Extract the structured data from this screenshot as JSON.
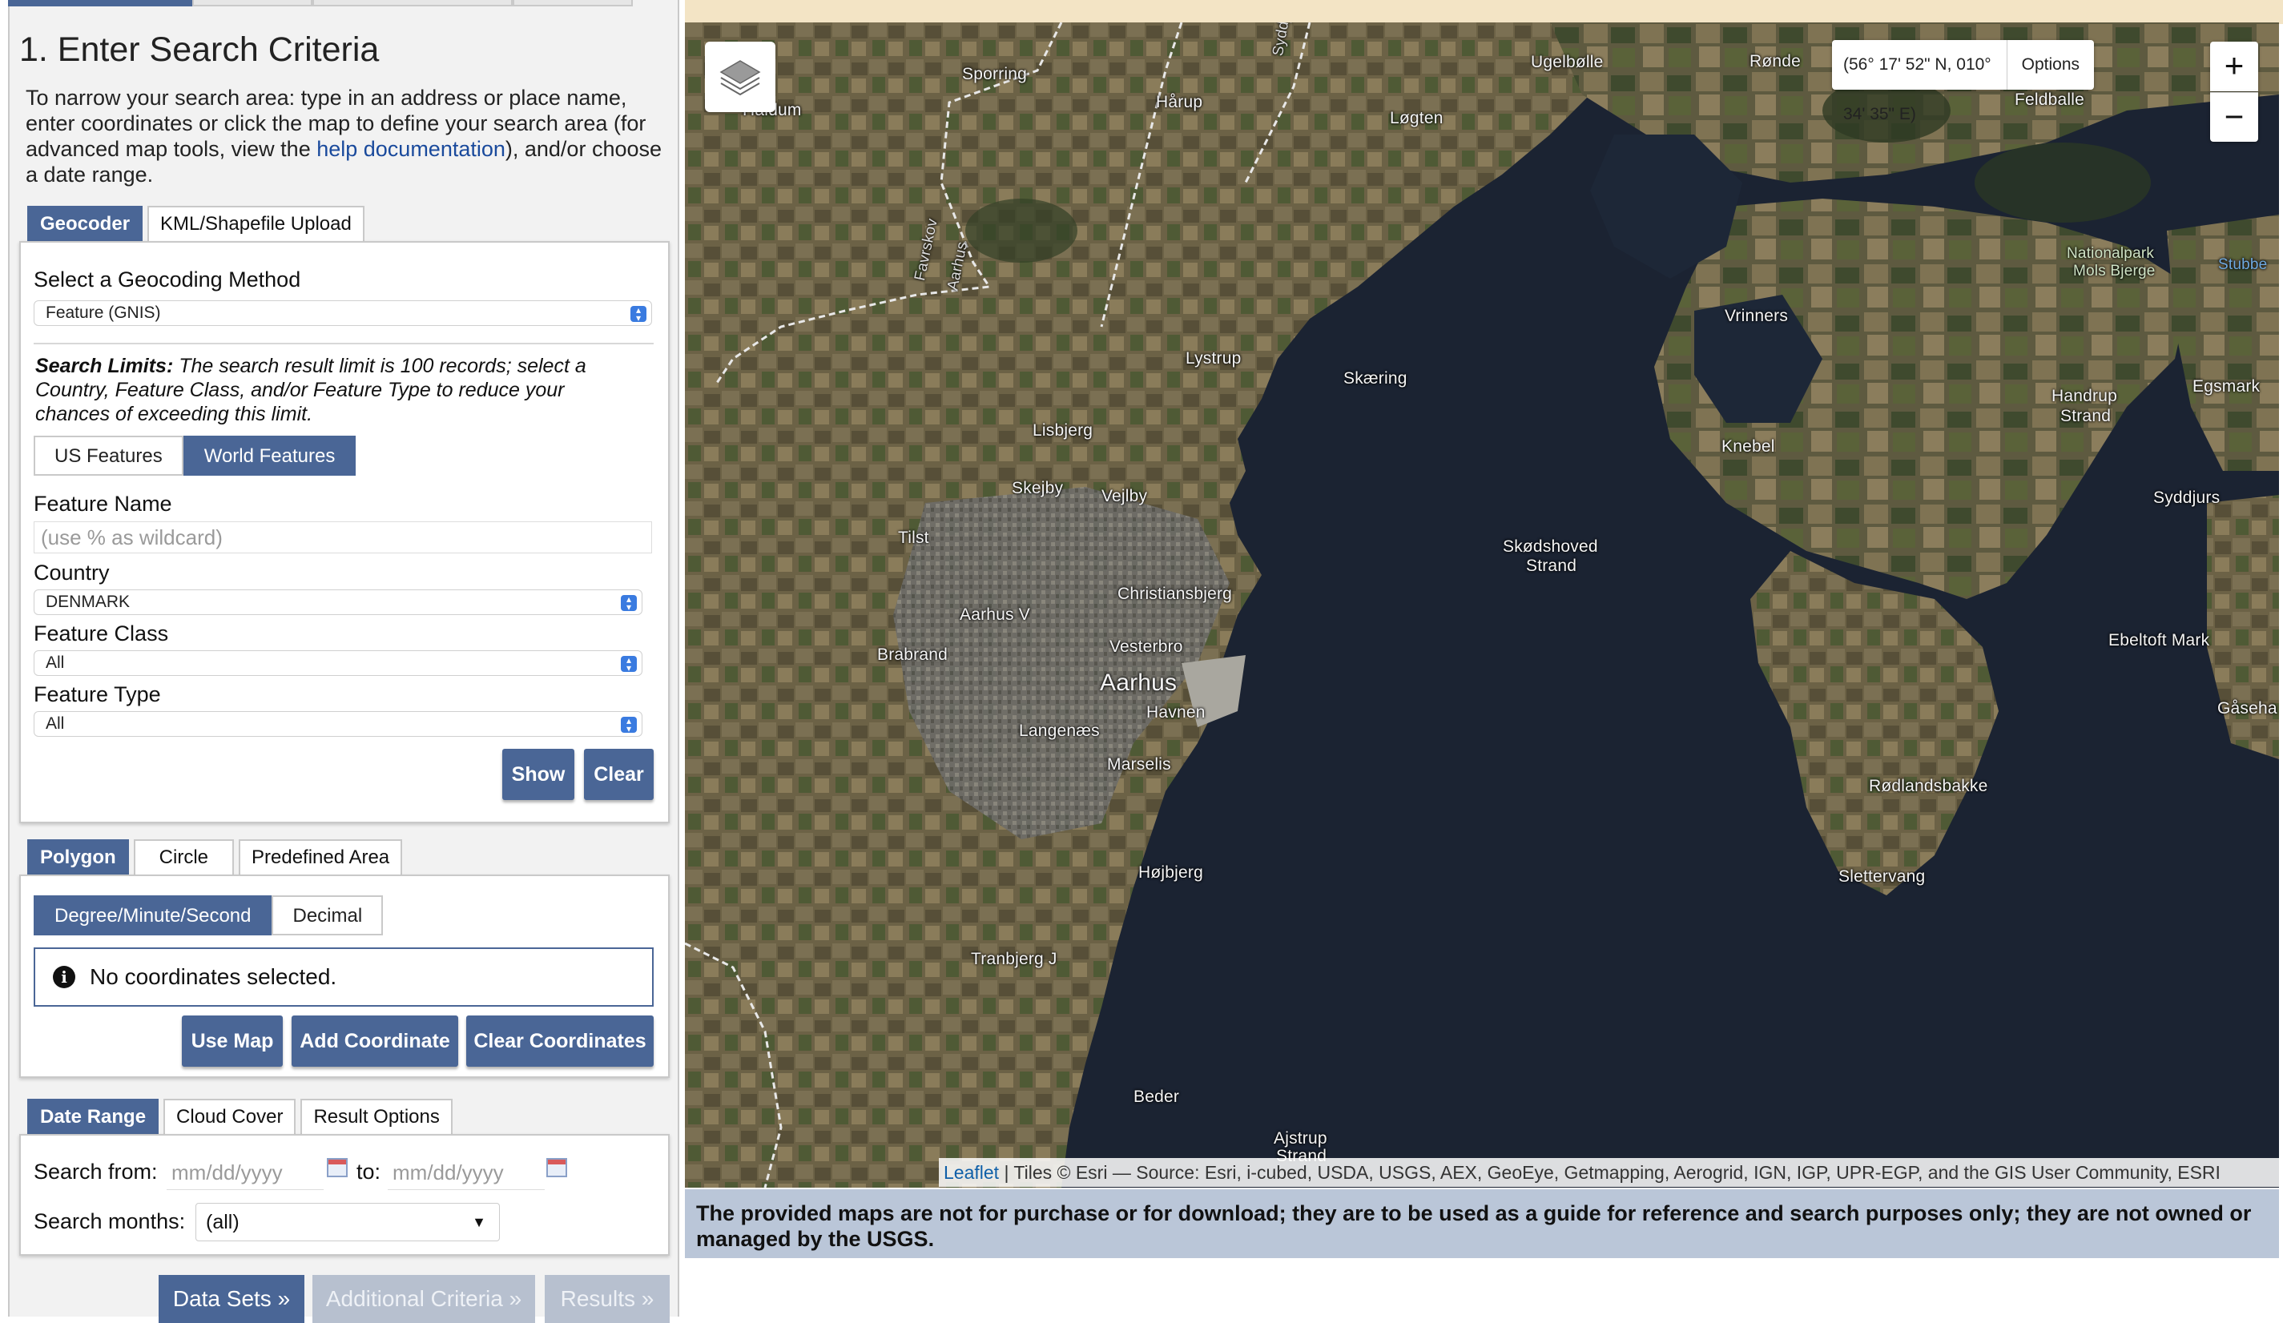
{
  "left_panel": {
    "heading": "1. Enter Search Criteria",
    "intro_part1": "To narrow your search area: type in an address or place name, enter coordinates or click the map to define your search area (for advanced map tools, view the ",
    "intro_link": "help documentation",
    "intro_part2": "), and/or choose a date range.",
    "top_tabs": [
      "Geocoder",
      "KML/Shapefile Upload"
    ],
    "geocoding_method_label": "Select a Geocoding Method",
    "geocoding_method_value": "Feature (GNIS)",
    "search_limits_bold": "Search Limits:",
    "search_limits_text": " The search result limit is 100 records; select a Country, Feature Class, and/or Feature Type to reduce your chances of exceeding this limit.",
    "feature_toggle": [
      "US Features",
      "World Features"
    ],
    "feature_name_label": "Feature Name",
    "feature_name_placeholder": "(use % as wildcard)",
    "country_label": "Country",
    "country_value": "DENMARK",
    "feature_class_label": "Feature Class",
    "feature_class_value": "All",
    "feature_type_label": "Feature Type",
    "feature_type_value": "All",
    "show_button": "Show",
    "clear_button": "Clear",
    "area_tabs": [
      "Polygon",
      "Circle",
      "Predefined Area"
    ],
    "coord_format": [
      "Degree/Minute/Second",
      "Decimal"
    ],
    "no_coords": "No coordinates selected.",
    "use_map_button": "Use Map",
    "add_coord_button": "Add Coordinate",
    "clear_coords_button": "Clear Coordinates",
    "date_tabs": [
      "Date Range",
      "Cloud Cover",
      "Result Options"
    ],
    "search_from_label": "Search from:",
    "to_label": "to:",
    "date_placeholder": "mm/dd/yyyy",
    "search_months_label": "Search months:",
    "search_months_value": "(all)",
    "nav_buttons": [
      "Data Sets »",
      "Additional Criteria »",
      "Results »"
    ]
  },
  "map": {
    "coord_readout": "(56° 17' 52\" N, 010° 34' 35\" E)",
    "options_label": "Options",
    "zoom_in": "+",
    "zoom_out": "−",
    "attribution_link": "Leaflet",
    "attribution_text": " | Tiles © Esri — Source: Esri, i-cubed, USDA, USGS, AEX, GeoEye, Getmapping, Aerogrid, IGN, IGP, UPR-EGP, and the GIS User Community, ESRI",
    "disclaimer": "The provided maps are not for purchase or for download; they are to be used as a guide for reference and search purposes only; they are not owned or managed by the USGS.",
    "labels": {
      "sporring": "Sporring",
      "syddjurs_road": "Syddjurs",
      "ugelbolle": "Ugelbølle",
      "ronde": "Rønde",
      "haldum": "Haldum",
      "harup": "Hårup",
      "logten": "Løgten",
      "feldballe": "Feldballe",
      "favrskov": "Favrskov",
      "aarhus_road": "Aarhus",
      "nationalpark": "Nationalpark",
      "mols_bjerge": "Mols Bjerge",
      "stubbe": "Stubbe",
      "vrinners": "Vrinners",
      "lystrup": "Lystrup",
      "skaering": "Skæring",
      "egsmark": "Egsmark",
      "handrup": "Handrup",
      "strand1": "Strand",
      "lisbjerg": "Lisbjerg",
      "knebel": "Knebel",
      "skejby": "Skejby",
      "vejlby": "Vejlby",
      "syddjurs": "Syddjurs",
      "tilst": "Tilst",
      "skodshoved": "Skødshoved",
      "strand2": "Strand",
      "christiansbjerg": "Christiansbjerg",
      "aarhus_v": "Aarhus V",
      "ebeltoft": "Ebeltoft Mark",
      "vesterbro": "Vesterbro",
      "brabrand": "Brabrand",
      "aarhus": "Aarhus",
      "havnen": "Havnen",
      "gaseha": "Gåseha",
      "langenaes": "Langenæs",
      "marselis": "Marselis",
      "rodlandsbakke": "Rødlandsbakke",
      "hojbjerg": "Højbjerg",
      "slettervang": "Slettervang",
      "tranbjerg": "Tranbjerg J",
      "beder": "Beder",
      "ajstrup": "Ajstrup",
      "strand3": "Strand"
    }
  }
}
